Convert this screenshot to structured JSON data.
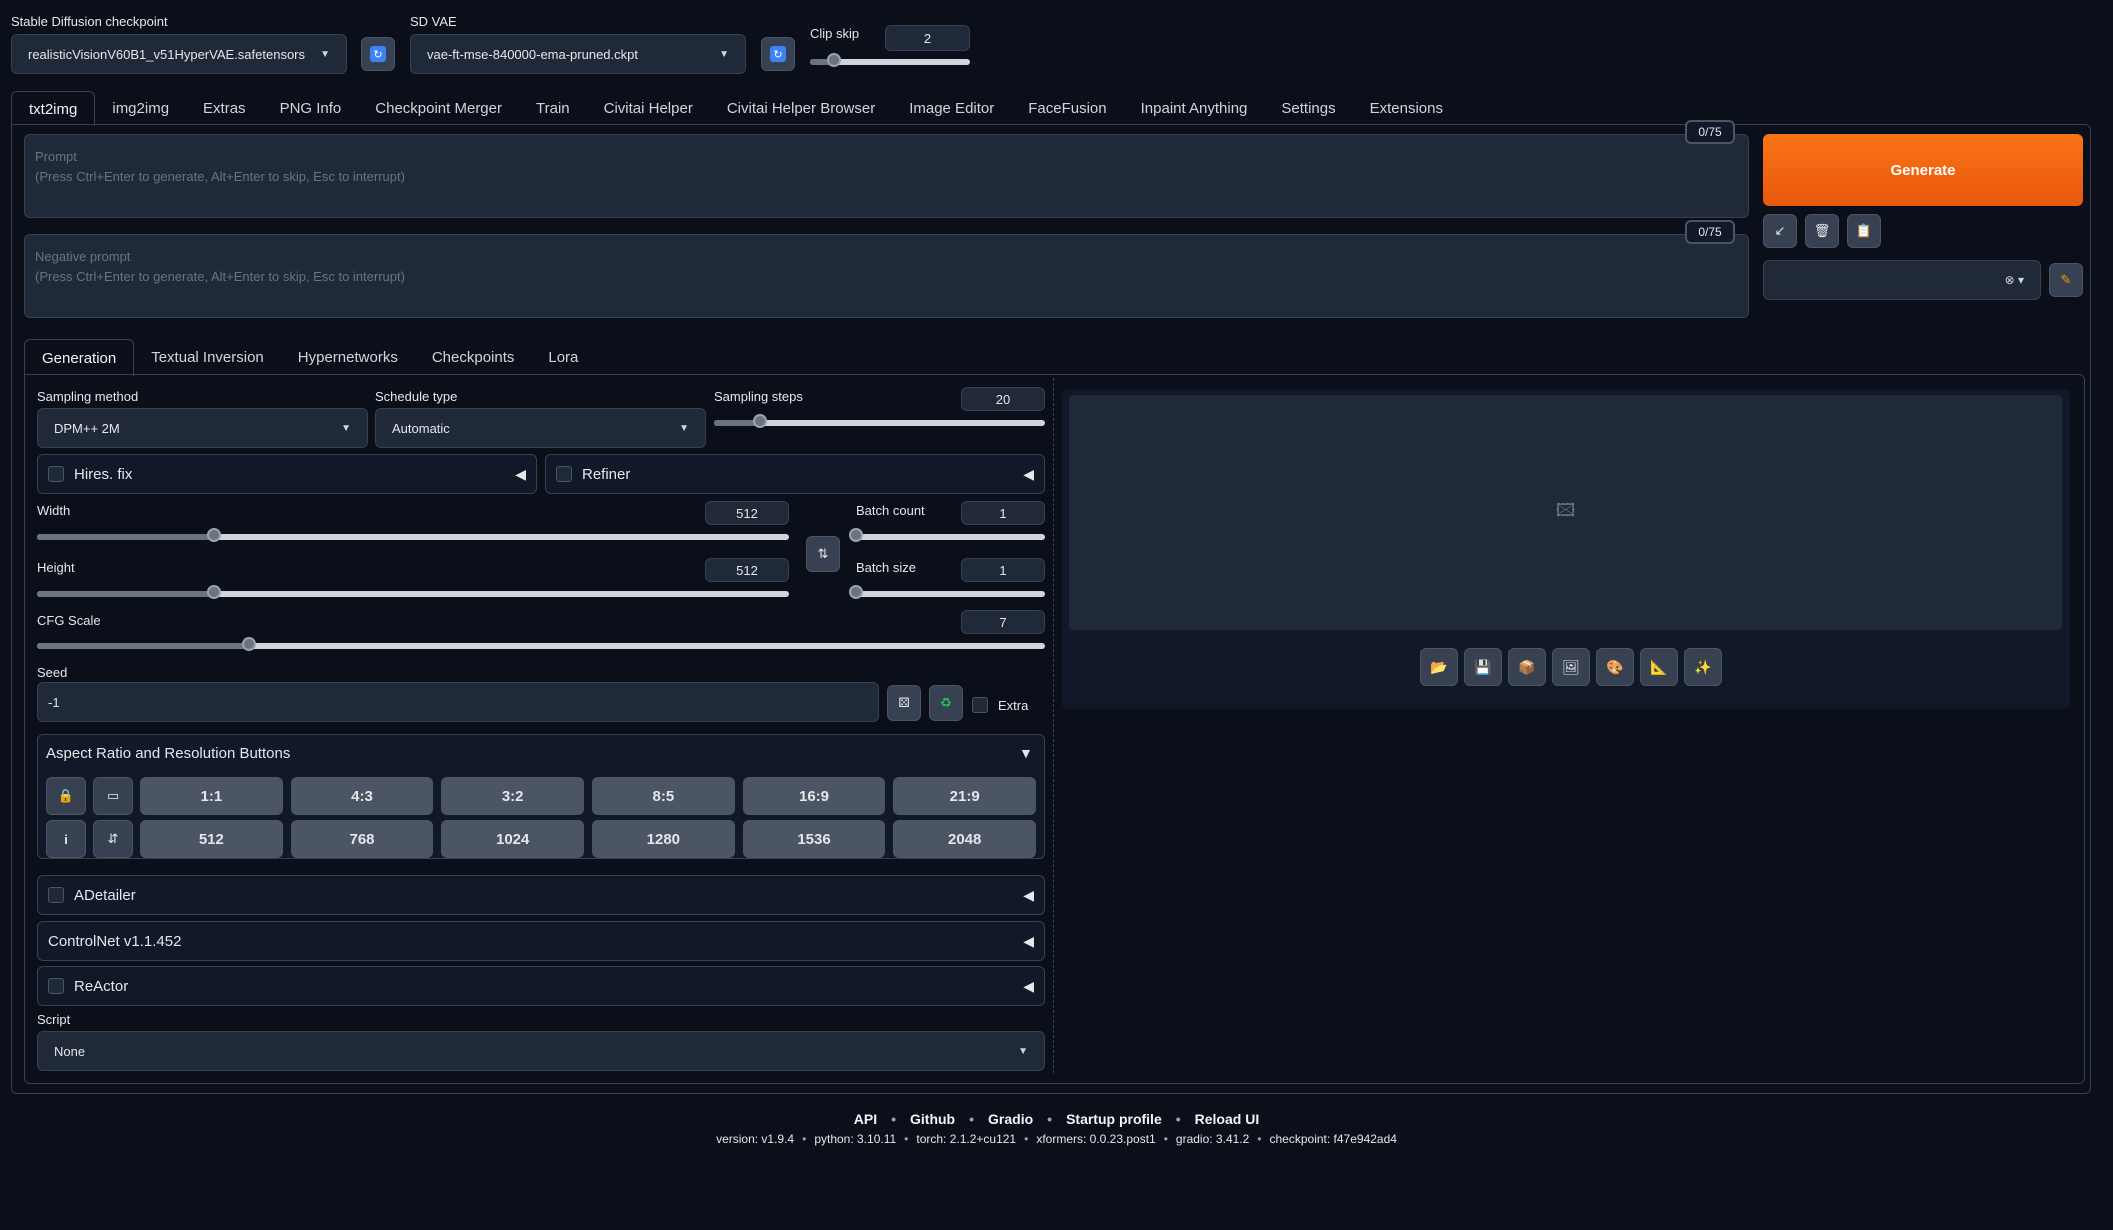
{
  "top": {
    "checkpoint_label": "Stable Diffusion checkpoint",
    "checkpoint_value": "realisticVisionV60B1_v51HyperVAE.safetensors",
    "vae_label": "SD VAE",
    "vae_value": "vae-ft-mse-840000-ema-pruned.ckpt",
    "clip_skip_label": "Clip skip",
    "clip_skip_value": "2",
    "clip_skip_fraction": 0.15
  },
  "main_tabs": [
    "txt2img",
    "img2img",
    "Extras",
    "PNG Info",
    "Checkpoint Merger",
    "Train",
    "Civitai Helper",
    "Civitai Helper Browser",
    "Image Editor",
    "FaceFusion",
    "Inpaint Anything",
    "Settings",
    "Extensions"
  ],
  "prompt": {
    "label": "Prompt",
    "hint": "(Press Ctrl+Enter to generate, Alt+Enter to skip, Esc to interrupt)",
    "counter": "0/75"
  },
  "negative": {
    "label": "Negative prompt",
    "hint": "(Press Ctrl+Enter to generate, Alt+Enter to skip, Esc to interrupt)",
    "counter": "0/75"
  },
  "generate_label": "Generate",
  "sub_tabs": [
    "Generation",
    "Textual Inversion",
    "Hypernetworks",
    "Checkpoints",
    "Lora"
  ],
  "sampling": {
    "method_label": "Sampling method",
    "method_value": "DPM++ 2M",
    "schedule_label": "Schedule type",
    "schedule_value": "Automatic",
    "steps_label": "Sampling steps",
    "steps_value": "20",
    "steps_fraction": 0.14
  },
  "hires_label": "Hires. fix",
  "refiner_label": "Refiner",
  "width": {
    "label": "Width",
    "value": "512",
    "fraction": 0.235
  },
  "height": {
    "label": "Height",
    "value": "512",
    "fraction": 0.235
  },
  "batch_count": {
    "label": "Batch count",
    "value": "1",
    "fraction": 0.0
  },
  "batch_size": {
    "label": "Batch size",
    "value": "1",
    "fraction": 0.0
  },
  "cfg": {
    "label": "CFG Scale",
    "value": "7",
    "fraction": 0.21
  },
  "seed": {
    "label": "Seed",
    "value": "-1",
    "extra_label": "Extra"
  },
  "aspect": {
    "title": "Aspect Ratio and Resolution Buttons",
    "ratios": [
      "1:1",
      "4:3",
      "3:2",
      "8:5",
      "16:9",
      "21:9"
    ],
    "resolutions": [
      "512",
      "768",
      "1024",
      "1280",
      "1536",
      "2048"
    ]
  },
  "adetailer_label": "ADetailer",
  "controlnet_label": "ControlNet v1.1.452",
  "reactor_label": "ReActor",
  "script": {
    "label": "Script",
    "value": "None"
  },
  "footer": {
    "links": [
      "API",
      "Github",
      "Gradio",
      "Startup profile",
      "Reload UI"
    ],
    "version": "version: v1.9.4",
    "python": "python: 3.10.11",
    "torch": "torch: 2.1.2+cu121",
    "xformers": "xformers: 0.0.23.post1",
    "gradio": "gradio: 3.41.2",
    "checkpoint": "checkpoint: f47e942ad4"
  },
  "colors": {
    "accent": "#f97316",
    "background": "#0b0f19",
    "panel": "#111827"
  }
}
